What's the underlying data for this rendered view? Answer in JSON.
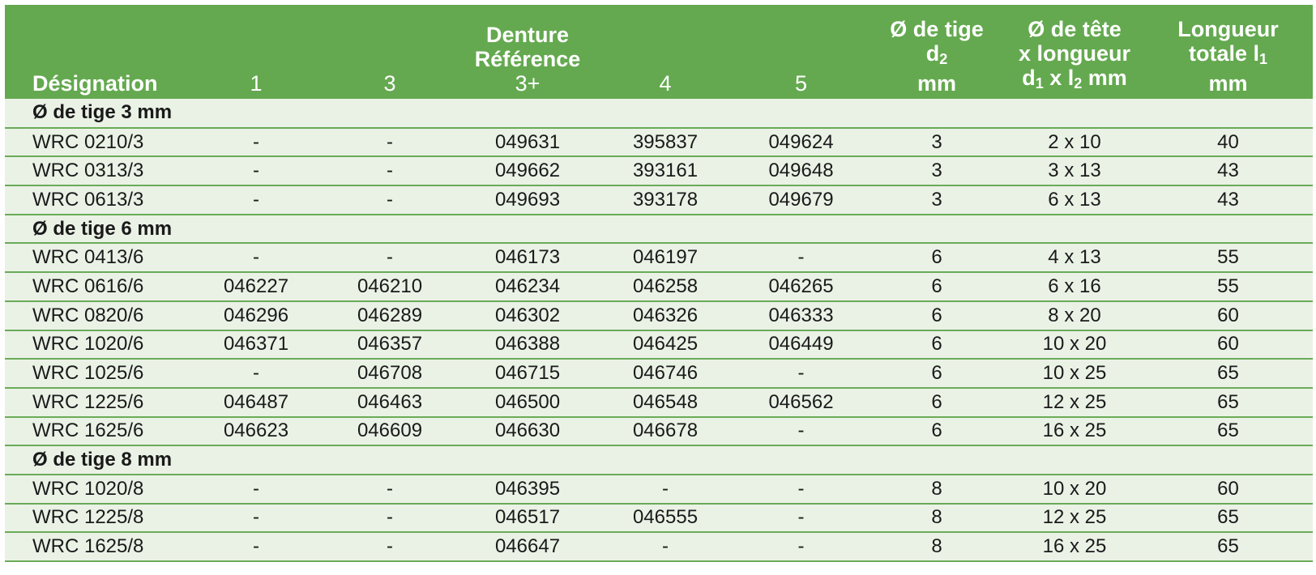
{
  "header": {
    "designation": "Désignation",
    "denture_line1": "Denture",
    "denture_line2": "Référence",
    "ref_cols": [
      "1",
      "3",
      "3+",
      "4",
      "5"
    ],
    "tige_line1": "Ø de tige",
    "tige_d": "d",
    "tige_sub": "2",
    "tige_unit": "mm",
    "tete_line1": "Ø de tête",
    "tete_line2": "x longueur",
    "tete_d": "d",
    "tete_d_sub": "1",
    "tete_x": " x l",
    "tete_l_sub": "2",
    "tete_unit": " mm",
    "long_line1": "Longueur",
    "long_line2": "totale l",
    "long_sub": "1",
    "long_unit": "mm"
  },
  "sections": [
    {
      "title": "Ø de tige 3 mm",
      "rows": [
        [
          "WRC 0210/3",
          "-",
          "-",
          "049631",
          "395837",
          "049624",
          "3",
          "2 x 10",
          "40"
        ],
        [
          "WRC 0313/3",
          "-",
          "-",
          "049662",
          "393161",
          "049648",
          "3",
          "3 x 13",
          "43"
        ],
        [
          "WRC 0613/3",
          "-",
          "-",
          "049693",
          "393178",
          "049679",
          "3",
          "6 x 13",
          "43"
        ]
      ]
    },
    {
      "title": "Ø de tige 6 mm",
      "rows": [
        [
          "WRC 0413/6",
          "-",
          "-",
          "046173",
          "046197",
          "-",
          "6",
          "4 x 13",
          "55"
        ],
        [
          "WRC 0616/6",
          "046227",
          "046210",
          "046234",
          "046258",
          "046265",
          "6",
          "6 x 16",
          "55"
        ],
        [
          "WRC 0820/6",
          "046296",
          "046289",
          "046302",
          "046326",
          "046333",
          "6",
          "8 x 20",
          "60"
        ],
        [
          "WRC 1020/6",
          "046371",
          "046357",
          "046388",
          "046425",
          "046449",
          "6",
          "10 x 20",
          "60"
        ],
        [
          "WRC 1025/6",
          "-",
          "046708",
          "046715",
          "046746",
          "-",
          "6",
          "10 x 25",
          "65"
        ],
        [
          "WRC 1225/6",
          "046487",
          "046463",
          "046500",
          "046548",
          "046562",
          "6",
          "12 x 25",
          "65"
        ],
        [
          "WRC 1625/6",
          "046623",
          "046609",
          "046630",
          "046678",
          "-",
          "6",
          "16 x 25",
          "65"
        ]
      ]
    },
    {
      "title": "Ø de tige 8 mm",
      "rows": [
        [
          "WRC 1020/8",
          "-",
          "-",
          "046395",
          "-",
          "-",
          "8",
          "10 x 20",
          "60"
        ],
        [
          "WRC 1225/8",
          "-",
          "-",
          "046517",
          "046555",
          "-",
          "8",
          "12 x 25",
          "65"
        ],
        [
          "WRC 1625/8",
          "-",
          "-",
          "046647",
          "-",
          "-",
          "8",
          "16 x 25",
          "65"
        ]
      ]
    }
  ],
  "colors": {
    "header_bg": "#64a94f",
    "body_bg": "#eaf2e6",
    "rule": "#6aab58"
  }
}
